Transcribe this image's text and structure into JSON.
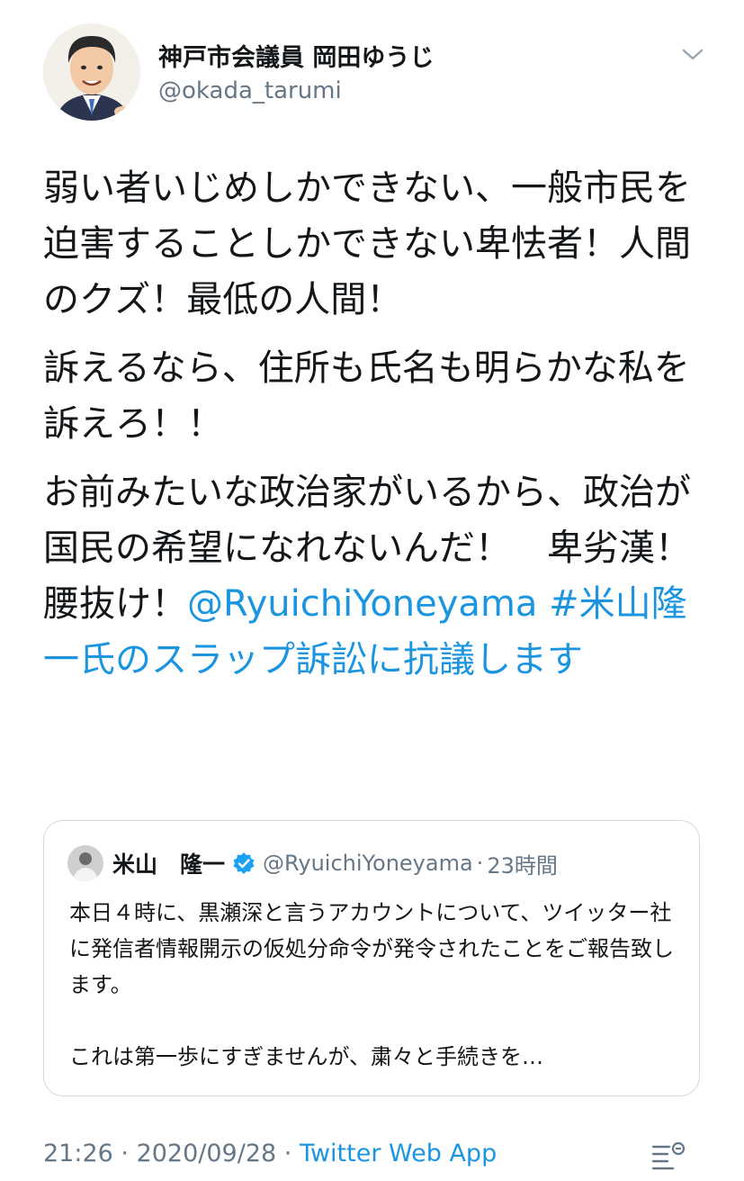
{
  "author": {
    "display_name": "神戸市会議員 岡田ゆうじ",
    "handle": "@okada_tarumi"
  },
  "tweet": {
    "paragraphs": [
      "弱い者いじめしかできない、一般市民を迫害することしかできない卑怯者！人間のクズ！最低の人間！",
      "訴えるなら、住所も氏名も明らかな私を訴えろ！！"
    ],
    "p3_text": "お前みたいな政治家がいるから、政治が国民の希望になれないんだ！　卑劣漢！　腰抜け！",
    "mention": "@RyuichiYoneyama",
    "hashtag": "#米山隆一氏のスラップ訴訟に抗議します"
  },
  "quote": {
    "name": "米山　隆一",
    "handle": "@RyuichiYoneyama",
    "separator": "·",
    "time": "23時間",
    "text_1": "本日４時に、黒瀬深と言うアカウントについて、ツイッター社に発信者情報開示の仮処分命令が発令されたことをご報告致します。",
    "text_2": "これは第一歩にすぎませんが、粛々と手続きを…"
  },
  "meta": {
    "time": "21:26",
    "separator_1": " · ",
    "date": "2020/09/28",
    "separator_2": " · ",
    "app": "Twitter Web App"
  },
  "icons": {
    "caret": "chevron-down-icon",
    "verified": "verified-badge-icon",
    "analytics": "tweet-analytics-icon"
  },
  "colors": {
    "link": "#1b95e0",
    "secondary": "#657786",
    "text": "#14171a",
    "border": "#cfd9de"
  }
}
